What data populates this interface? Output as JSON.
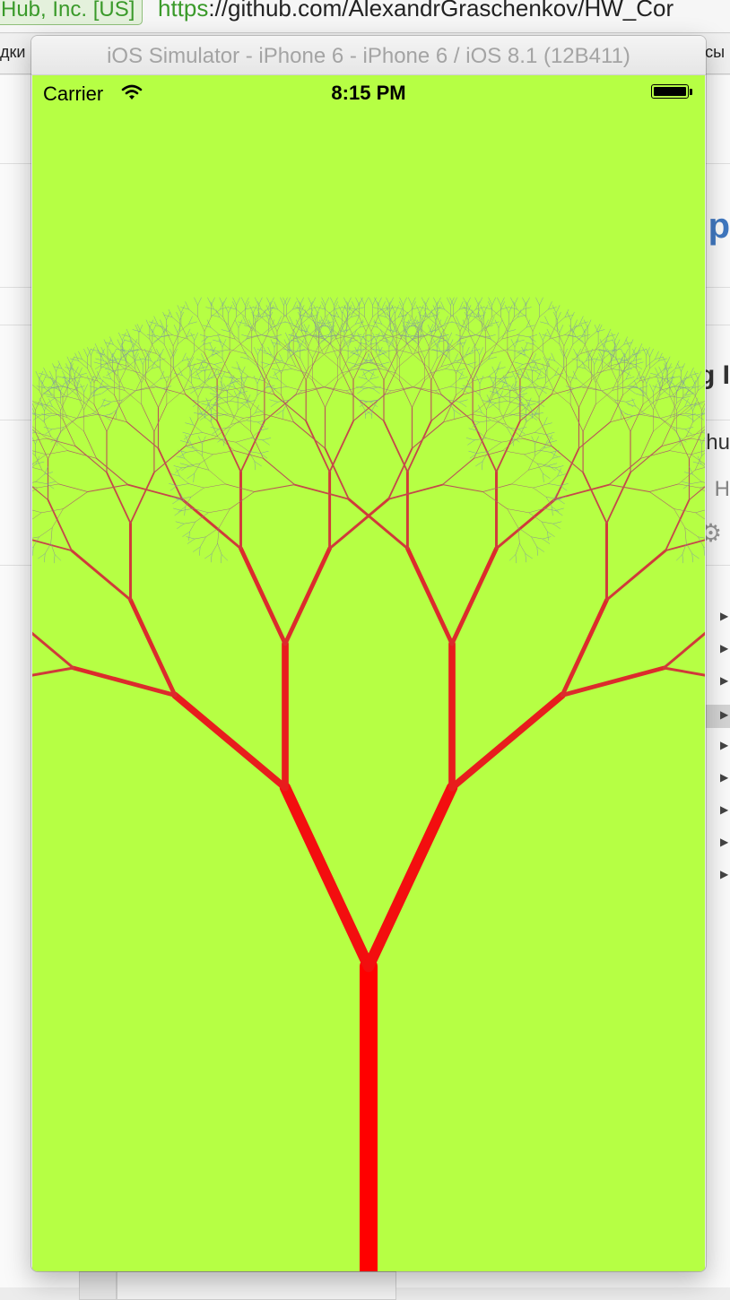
{
  "browser": {
    "cert_label": "Hub, Inc. [US]",
    "url_scheme": "https",
    "url_rest": "://github.com/AlexandrGraschenkov/HW_Cor",
    "bookmark_left": "дки",
    "bookmark_right": "сы"
  },
  "background_fragments": [
    "p",
    "g I",
    "thu",
    "H"
  ],
  "simulator": {
    "title": "iOS Simulator - iPhone 6 - iPhone 6 / iOS 8.1 (12B411)"
  },
  "status_bar": {
    "carrier": "Carrier",
    "time": "8:15 PM",
    "icons": [
      "wifi-icon",
      "battery-icon"
    ]
  },
  "app": {
    "background_color": "#b6ff44",
    "tree": {
      "trunk_color": "#ff0000",
      "tip_color": "#7f9fa0",
      "depth": 12,
      "branch_angle_deg": 25,
      "length_ratio": 0.73
    }
  }
}
